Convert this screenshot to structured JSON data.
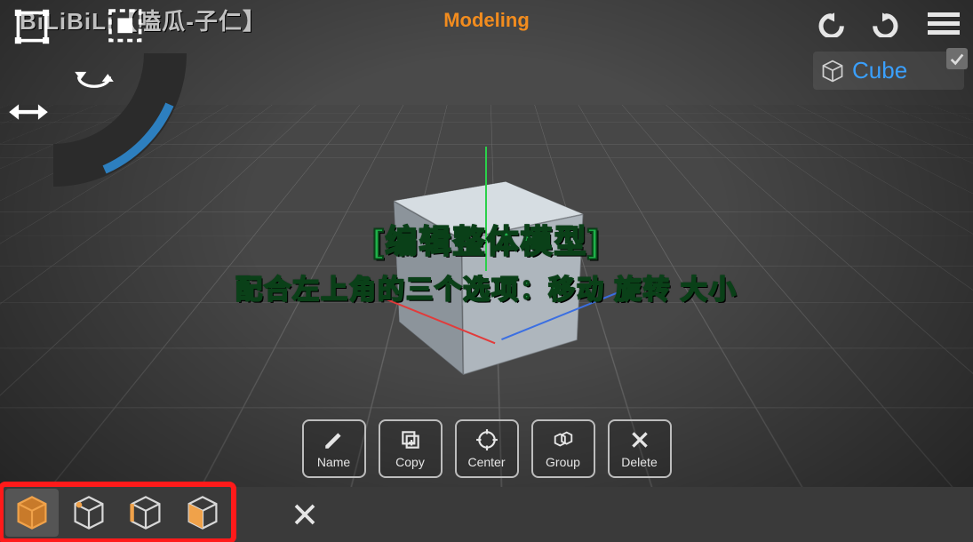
{
  "watermark": "BiLiBiLi【嗑瓜-子仁】",
  "header": {
    "title": "Modeling"
  },
  "topRight": {
    "undo": "undo",
    "redo": "redo",
    "menu": "menu"
  },
  "objectPanel": {
    "label": "Cube",
    "checked": true
  },
  "transformDial": {
    "move": "move",
    "scale": "scale",
    "rotate": "rotate",
    "pan": "pan"
  },
  "scene": {
    "selectedObject": "Cube",
    "gizmo": {
      "x": "red",
      "y": "green",
      "z": "blue"
    }
  },
  "caption": {
    "line1": "[编辑整体模型]",
    "line2": "配合左上角的三个选项：移动 旋转 大小"
  },
  "actions": {
    "name": {
      "label": "Name"
    },
    "copy": {
      "label": "Copy"
    },
    "center": {
      "label": "Center"
    },
    "group": {
      "label": "Group"
    },
    "delete": {
      "label": "Delete"
    }
  },
  "bottomModes": {
    "object": "object-mode",
    "vertex": "vertex-mode",
    "edge": "edge-mode",
    "face": "face-mode",
    "close": "close"
  },
  "colors": {
    "accent": "#f28c1e",
    "link": "#3aa0ff",
    "highlight": "#ff1a1a",
    "captionGreen": "#1fb24a"
  }
}
